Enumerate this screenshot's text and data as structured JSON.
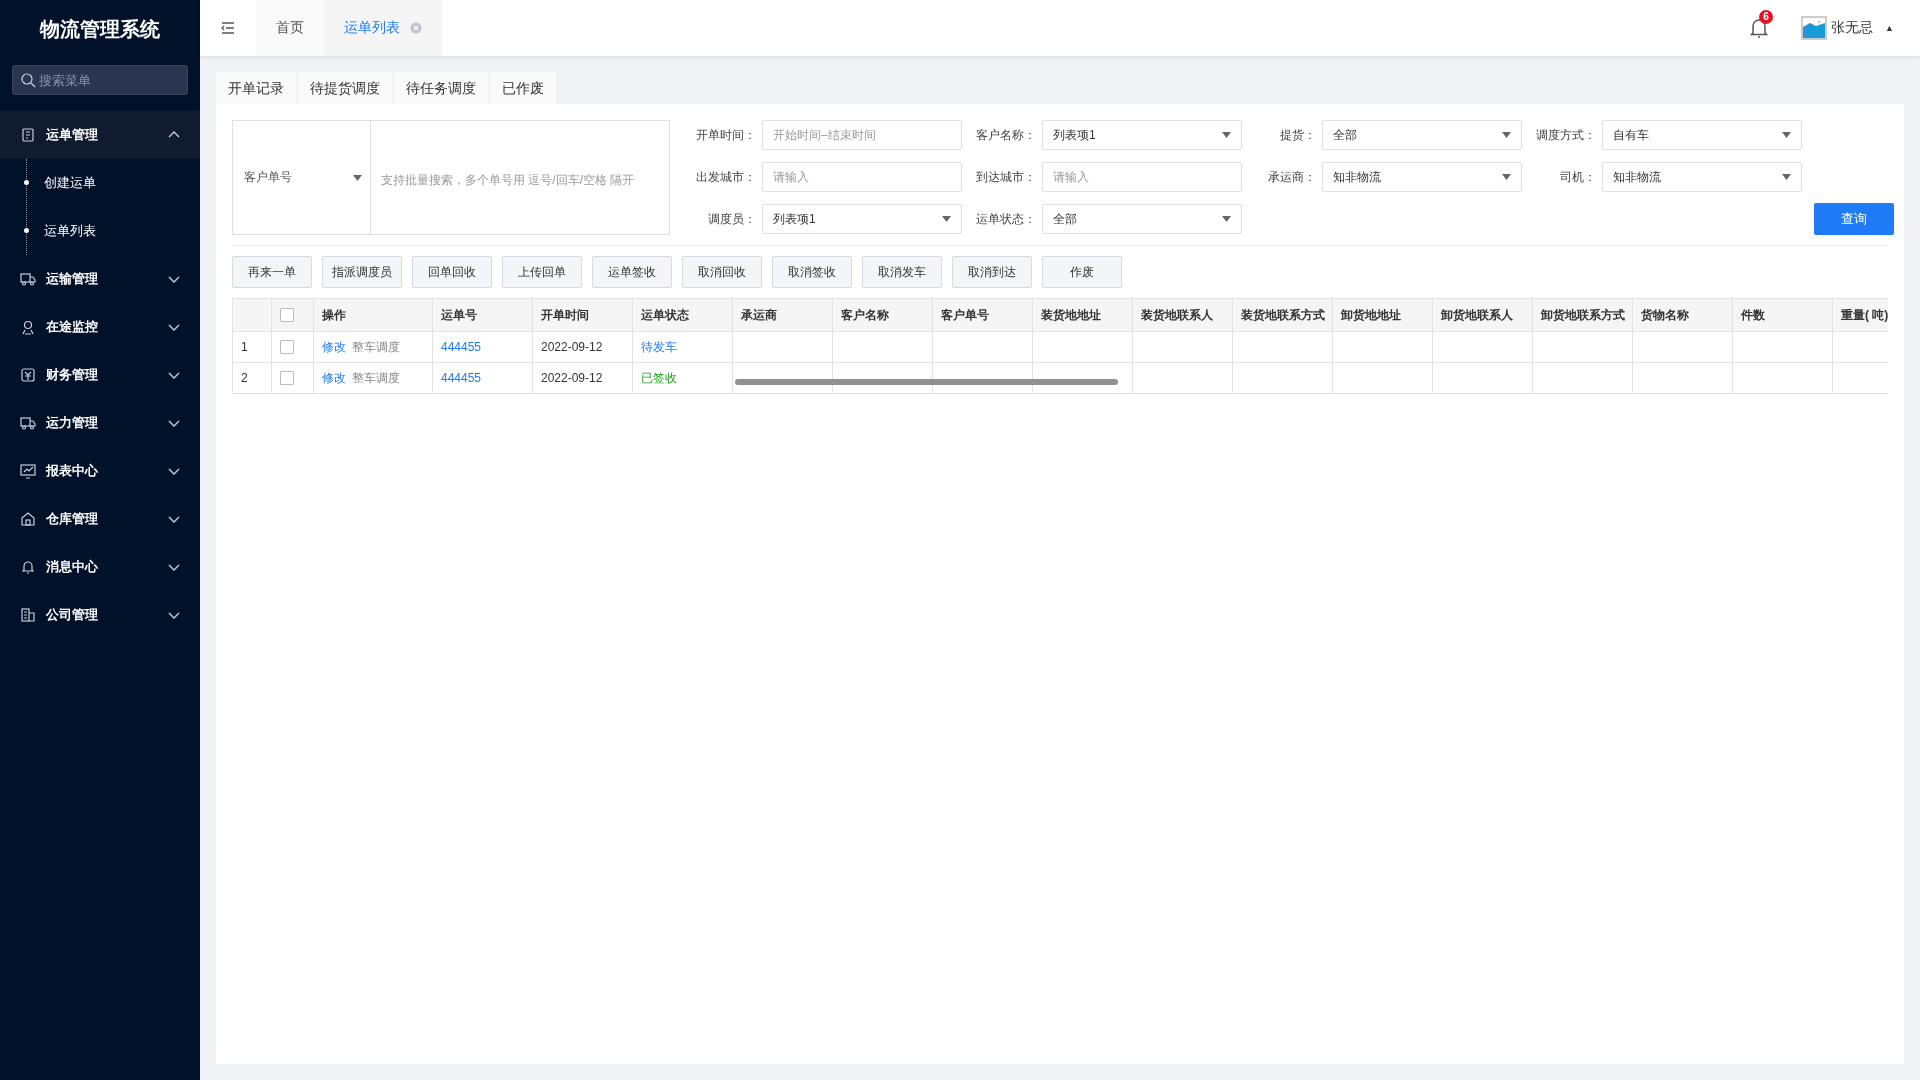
{
  "sidebar": {
    "title": "物流管理系统",
    "search": {
      "placeholder": "搜索菜单"
    },
    "items": [
      {
        "label": "运单管理",
        "expanded": true,
        "children": [
          {
            "label": "创建运单"
          },
          {
            "label": "运单列表"
          }
        ]
      },
      {
        "label": "运输管理",
        "expanded": false
      },
      {
        "label": "在途监控",
        "expanded": false
      },
      {
        "label": "财务管理",
        "expanded": false
      },
      {
        "label": "运力管理",
        "expanded": false
      },
      {
        "label": "报表中心",
        "expanded": false
      },
      {
        "label": "仓库管理",
        "expanded": false
      },
      {
        "label": "消息中心",
        "expanded": false
      },
      {
        "label": "公司管理",
        "expanded": false
      }
    ]
  },
  "header": {
    "tabs": [
      {
        "label": "首页",
        "selected": false
      },
      {
        "label": "运单列表",
        "selected": true
      }
    ],
    "notification_count": "6",
    "user": {
      "name": "张无忌",
      "caret": "▲"
    }
  },
  "sub_tabs": [
    "开单记录",
    "待提货调度",
    "待任务调度",
    "已作废"
  ],
  "filters": {
    "batch": {
      "type_select": "客户单号",
      "placeholder": "支持批量搜索，多个单号用 逗号/回车/空格 隔开"
    },
    "fields": [
      {
        "label": "开单时间：",
        "kind": "input",
        "placeholder": "开始时间–结束时间"
      },
      {
        "label": "客户名称：",
        "kind": "select",
        "value": "列表项1"
      },
      {
        "label": "提货：",
        "kind": "select",
        "value": "全部"
      },
      {
        "label": "调度方式：",
        "kind": "select",
        "value": "自有车"
      },
      {
        "label": "出发城市：",
        "kind": "input",
        "placeholder": "请输入"
      },
      {
        "label": "到达城市：",
        "kind": "input",
        "placeholder": "请输入"
      },
      {
        "label": "承运商：",
        "kind": "select",
        "value": "知非物流"
      },
      {
        "label": "司机：",
        "kind": "select",
        "value": "知非物流"
      },
      {
        "label": "调度员：",
        "kind": "select",
        "value": "列表项1"
      },
      {
        "label": "运单状态：",
        "kind": "select",
        "value": "全部"
      }
    ],
    "query_button": "查询"
  },
  "actions": [
    "再来一单",
    "指派调度员",
    "回单回收",
    "上传回单",
    "运单签收",
    "取消回收",
    "取消签收",
    "取消发车",
    "取消到达",
    "作废"
  ],
  "table": {
    "header_checked": false,
    "columns": [
      "操作",
      "运单号",
      "开单时间",
      "运单状态",
      "承运商",
      "客户名称",
      "客户单号",
      "装货地地址",
      "装货地联系人",
      "装货地联系方式",
      "卸货地地址",
      "卸货地联系人",
      "卸货地联系方式",
      "货物名称",
      "件数",
      "重量( 吨)"
    ],
    "rows": [
      {
        "index": "1",
        "checked": false,
        "actions": [
          "修改",
          "整车调度"
        ],
        "waybill": "444455",
        "date": "2022-09-12",
        "status": "待发车",
        "kind": "pending"
      },
      {
        "index": "2",
        "checked": false,
        "actions": [
          "修改",
          "整车调度"
        ],
        "waybill": "444455",
        "date": "2022-09-12",
        "status": "已签收",
        "kind": "signed"
      }
    ]
  }
}
